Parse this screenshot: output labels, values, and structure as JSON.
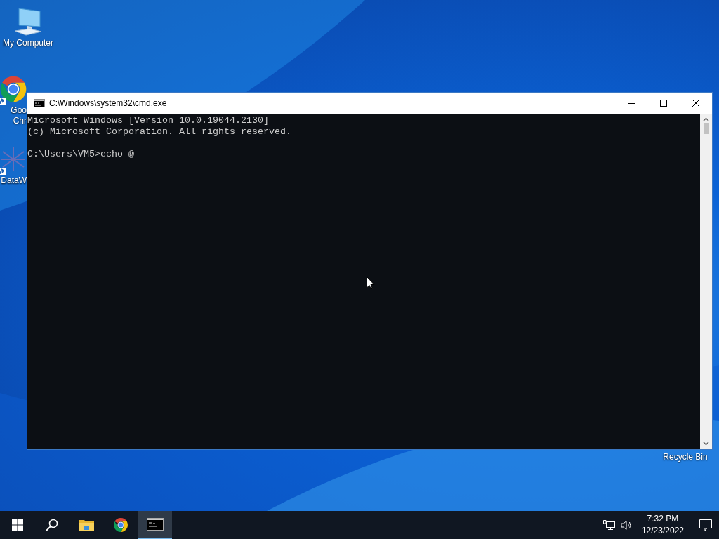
{
  "desktop_icons": [
    {
      "kind": "computer",
      "lines": [
        "My Computer"
      ]
    },
    {
      "kind": "chrome",
      "lines": [
        "Goo",
        "Chr"
      ]
    },
    {
      "kind": "datawrapper",
      "lines": [
        "DataW"
      ]
    },
    {
      "kind": "recycle",
      "lines": [
        "Recycle Bin"
      ]
    }
  ],
  "window": {
    "title": "C:\\Windows\\system32\\cmd.exe",
    "output": [
      "Microsoft Windows [Version 10.0.19044.2130]",
      "(c) Microsoft Corporation. All rights reserved."
    ],
    "prompt": "C:\\Users\\VM5>echo @"
  },
  "taskbar": {
    "items": [
      {
        "kind": "start",
        "selected": false
      },
      {
        "kind": "search",
        "selected": false
      },
      {
        "kind": "explorer",
        "selected": false
      },
      {
        "kind": "chrome",
        "selected": false
      },
      {
        "kind": "cmd",
        "selected": true
      }
    ],
    "time": "7:32 PM",
    "date": "12/23/2022"
  }
}
